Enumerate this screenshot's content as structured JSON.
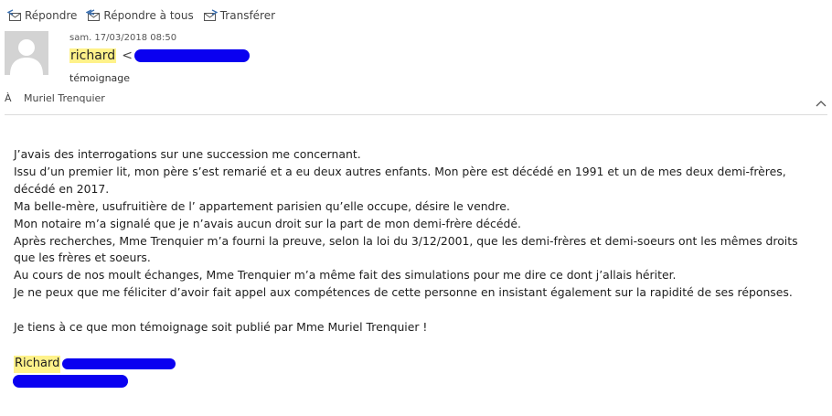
{
  "toolbar": {
    "reply": "Répondre",
    "reply_all": "Répondre à tous",
    "forward": "Transférer"
  },
  "header": {
    "date": "sam. 17/03/2018 08:50",
    "sender_name": "richard",
    "sender_open": "<",
    "subject": "témoignage",
    "to_label": "À",
    "recipient": "Muriel Trenquier"
  },
  "body": {
    "lines": [
      "J’avais des interrogations sur une succession me concernant.",
      "Issu d’un premier lit, mon père s’est remarié et a eu deux autres enfants. Mon père est décédé en 1991 et un de mes deux demi-frères, décédé en 2017.",
      "Ma belle-mère, usufruitière de l’ appartement parisien qu’elle occupe, désire le vendre.",
      "Mon notaire m’a signalé que je n’avais aucun droit sur la part de mon demi-frère décédé.",
      "Après recherches, Mme Trenquier m’a fourni la preuve, selon la loi du 3/12/2001, que les demi-frères et demi-soeurs ont les mêmes droits que les frères et soeurs.",
      "Au cours de nos moult échanges, Mme Trenquier m’a même fait des simulations pour me dire ce dont j’allais hériter.",
      "Je ne peux que me féliciter d’avoir fait appel aux compétences de cette personne en insistant également sur la rapidité de ses réponses."
    ],
    "closing": "Je tiens à ce que mon témoignage soit publié par Mme Muriel Trenquier !",
    "signature_name": "Richard"
  },
  "colors": {
    "highlight": "#fff28a",
    "redaction": "#0a00f0"
  }
}
